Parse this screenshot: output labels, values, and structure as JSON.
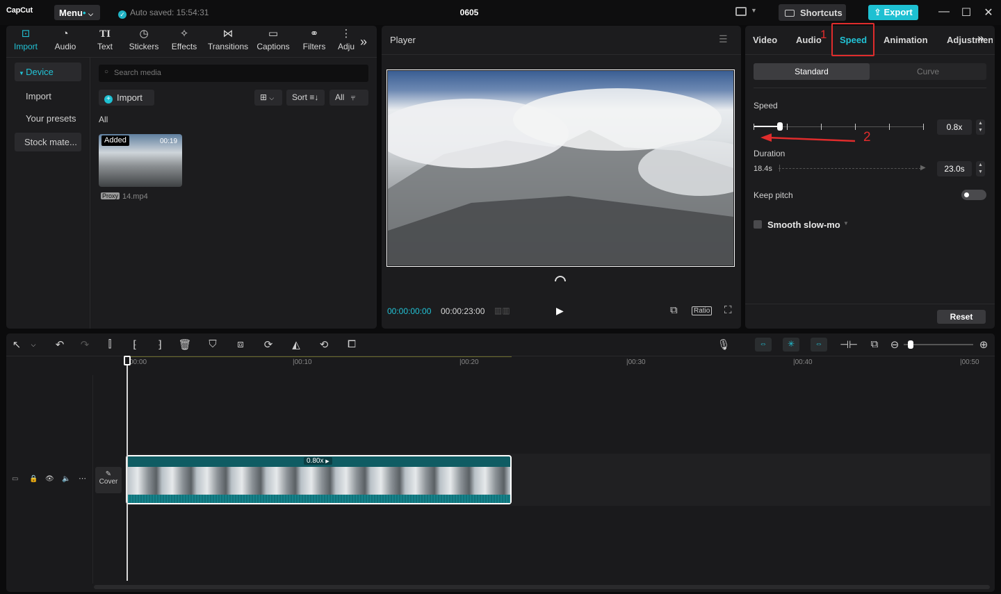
{
  "app": {
    "logo": "CapCut",
    "menu_label": "Menu",
    "autosave": "Auto saved: 15:54:31",
    "project_title": "0605",
    "shortcuts_label": "Shortcuts",
    "export_label": "Export"
  },
  "left_toolbar": [
    {
      "label": "Import",
      "icon": "import-icon"
    },
    {
      "label": "Audio",
      "icon": "audio-icon"
    },
    {
      "label": "Text",
      "icon": "text-icon"
    },
    {
      "label": "Stickers",
      "icon": "sticker-icon"
    },
    {
      "label": "Effects",
      "icon": "effects-icon"
    },
    {
      "label": "Transitions",
      "icon": "transitions-icon"
    },
    {
      "label": "Captions",
      "icon": "captions-icon"
    },
    {
      "label": "Filters",
      "icon": "filters-icon"
    },
    {
      "label": "Adju",
      "icon": "adjust-icon"
    }
  ],
  "sidebar": {
    "items": [
      "Device",
      "Import",
      "Your presets",
      "Stock mate..."
    ]
  },
  "media": {
    "search_placeholder": "Search media",
    "import_label": "Import",
    "sort_label": "Sort",
    "filter_label": "All",
    "section_label": "All",
    "clip": {
      "badge": "Added",
      "duration": "00:19",
      "proxy": "Proxy",
      "filename": "14.mp4"
    }
  },
  "player": {
    "title": "Player",
    "current_time": "00:00:00:00",
    "total_time": "00:00:23:00",
    "ratio_label": "Ratio"
  },
  "right_panel": {
    "tabs": [
      "Video",
      "Audio",
      "Speed",
      "Animation",
      "Adjustmen"
    ],
    "active_tab": "Speed",
    "segments": [
      "Standard",
      "Curve"
    ],
    "speed_label": "Speed",
    "speed_value": "0.8x",
    "duration_label": "Duration",
    "duration_original": "18.4s",
    "duration_value": "23.0s",
    "keep_pitch_label": "Keep pitch",
    "keep_pitch_on": false,
    "smooth_label": "Smooth slow-mo",
    "smooth_checked": false,
    "reset_label": "Reset",
    "annotation_1": "1",
    "annotation_2": "2",
    "highlight_color": "#e02c2c"
  },
  "timeline": {
    "ruler": [
      "00:00",
      "|00:10",
      "|00:20",
      "|00:30",
      "|00:40",
      "|00:50"
    ],
    "clip_speed_label": "0.80x",
    "cover_label": "Cover"
  },
  "colors": {
    "accent": "#1ec0d2"
  }
}
